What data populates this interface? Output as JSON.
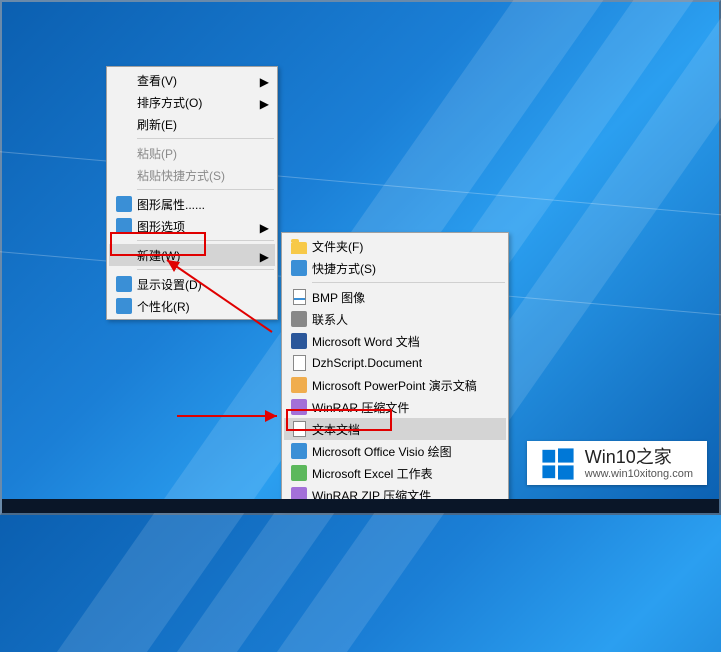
{
  "context_menu": {
    "view": "查看(V)",
    "sort": "排序方式(O)",
    "refresh": "刷新(E)",
    "paste": "粘贴(P)",
    "paste_shortcut": "粘贴快捷方式(S)",
    "graphics_properties": "图形属性......",
    "graphics_options": "图形选项",
    "new": "新建(W)",
    "display_settings": "显示设置(D)",
    "personalize": "个性化(R)"
  },
  "new_submenu": {
    "folder": "文件夹(F)",
    "shortcut": "快捷方式(S)",
    "bmp_image": "BMP 图像",
    "contact": "联系人",
    "word_doc": "Microsoft Word 文档",
    "dzh_script": "DzhScript.Document",
    "ppt_doc": "Microsoft PowerPoint 演示文稿",
    "winrar_archive": "WinRAR 压缩文件",
    "text_doc": "文本文档",
    "visio_doc": "Microsoft Office Visio 绘图",
    "excel_doc": "Microsoft Excel 工作表",
    "winrar_zip": "WinRAR ZIP 压缩文件"
  },
  "watermark": {
    "title": "Win10之家",
    "url": "www.win10xitong.com"
  }
}
